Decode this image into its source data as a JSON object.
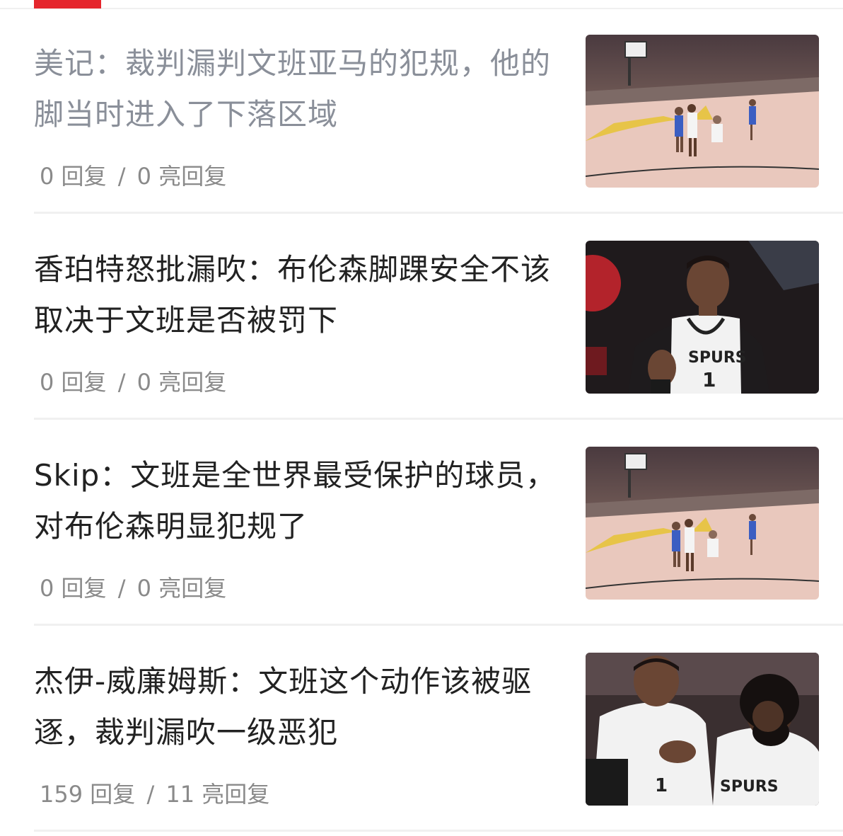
{
  "tabs": {
    "active_indicator_color": "#e5262d"
  },
  "feed": {
    "items": [
      {
        "title": "美记：裁判漏判文班亚马的犯规，他的脚当时进入了下落区域",
        "read": true,
        "replies": "0",
        "replies_label": "回复",
        "separator": "/",
        "light_replies": "0",
        "light_label": "亮回复",
        "thumbnail_icon": "basketball-court-photo"
      },
      {
        "title": "香珀特怒批漏吹：布伦森脚踝安全不该取决于文班是否被罚下",
        "read": false,
        "replies": "0",
        "replies_label": "回复",
        "separator": "/",
        "light_replies": "0",
        "light_label": "亮回复",
        "thumbnail_icon": "player-portrait-photo",
        "jersey_text": "SPURS",
        "jersey_number": "1"
      },
      {
        "title": "Skip：文班是全世界最受保护的球员，对布伦森明显犯规了",
        "read": false,
        "replies": "0",
        "replies_label": "回复",
        "separator": "/",
        "light_replies": "0",
        "light_label": "亮回复",
        "thumbnail_icon": "basketball-court-photo"
      },
      {
        "title": "杰伊-威廉姆斯：文班这个动作该被驱逐，裁判漏吹一级恶犯",
        "read": false,
        "replies": "159",
        "replies_label": "回复",
        "separator": "/",
        "light_replies": "11",
        "light_label": "亮回复",
        "thumbnail_icon": "two-players-photo",
        "jersey_text": "SPURS",
        "jersey_number": "1"
      }
    ]
  }
}
